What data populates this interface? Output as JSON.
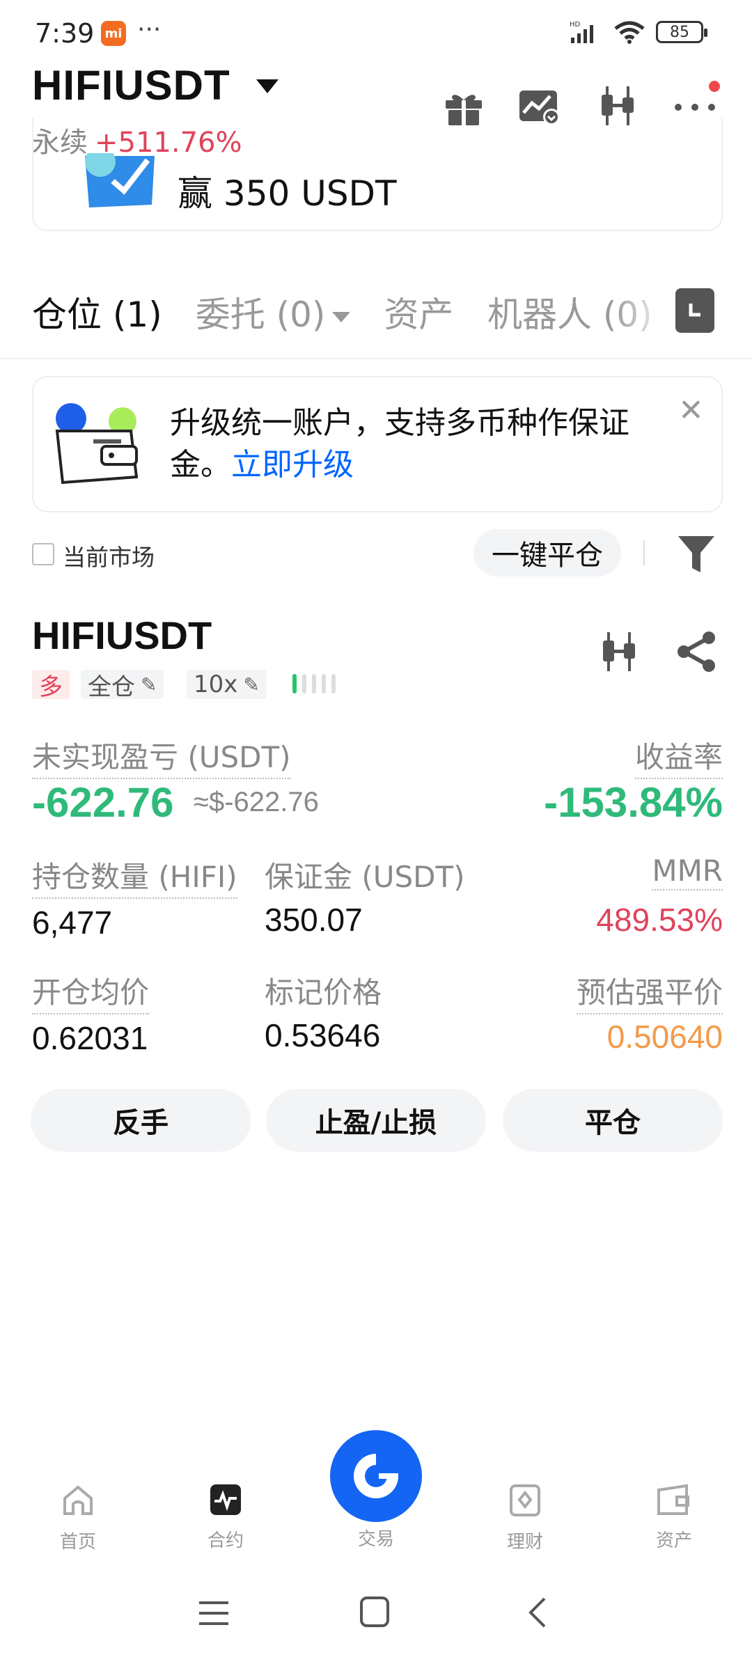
{
  "status_bar": {
    "time": "7:39",
    "mi_badge": "mi",
    "dots": "···",
    "network": "HD",
    "battery": "85"
  },
  "header": {
    "pair": "HIFIUSDT",
    "sub_type": "永续",
    "change": "+511.76%",
    "icons": [
      "gift-icon",
      "chart-alert-icon",
      "candlestick-icon",
      "more-icon"
    ]
  },
  "promo": {
    "text": "赢 350 USDT"
  },
  "tabs": [
    {
      "label": "仓位 (1)",
      "active": true
    },
    {
      "label": "委托 (0)",
      "active": false,
      "dropdown": true
    },
    {
      "label": "资产",
      "active": false
    },
    {
      "label": "机器人 (0)",
      "active": false
    }
  ],
  "upgrade_banner": {
    "text": "升级统一账户，支持多币种作保证金。",
    "link": "立即升级"
  },
  "filter": {
    "current_market_label": "当前市场",
    "close_all_label": "一键平仓"
  },
  "position": {
    "symbol": "HIFIUSDT",
    "side": "多",
    "margin_mode": "全仓",
    "leverage": "10x",
    "risk_level": 1,
    "unrealized_pnl_label": "未实现盈亏 (USDT)",
    "unrealized_pnl": "-622.76",
    "unrealized_pnl_usd": "≈$-622.76",
    "roe_label": "收益率",
    "roe": "-153.84%",
    "qty_label": "持仓数量 (HIFI)",
    "qty": "6,477",
    "margin_label": "保证金 (USDT)",
    "margin": "350.07",
    "mmr_label": "MMR",
    "mmr": "489.53%",
    "entry_label": "开仓均价",
    "entry": "0.62031",
    "mark_label": "标记价格",
    "mark": "0.53646",
    "liq_label": "预估强平价",
    "liq": "0.50640",
    "actions": [
      "反手",
      "止盈/止损",
      "平仓"
    ]
  },
  "bottom_nav": [
    {
      "label": "首页",
      "icon": "home-icon"
    },
    {
      "label": "合约",
      "icon": "futures-icon",
      "active": true
    },
    {
      "label": "交易",
      "icon": "trade-icon"
    },
    {
      "label": "理财",
      "icon": "earn-icon"
    },
    {
      "label": "资产",
      "icon": "wallet-icon"
    }
  ],
  "colors": {
    "profit_green": "#2fba7a",
    "loss_red": "#e0435a",
    "liq_orange": "#f29a4a",
    "link_blue": "#0066ff",
    "trade_blue": "#1565f5"
  }
}
